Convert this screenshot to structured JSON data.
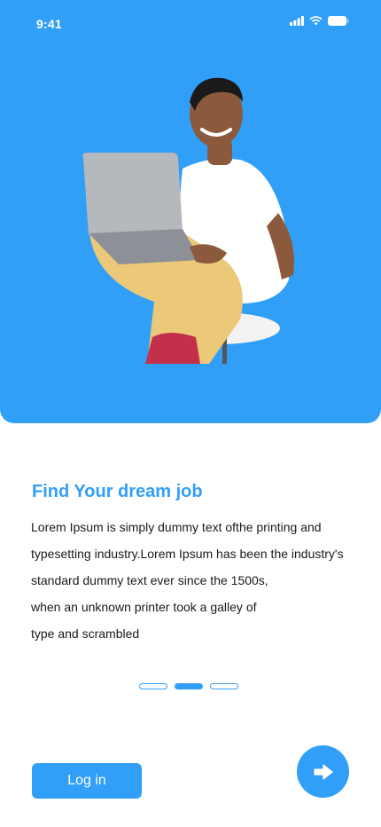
{
  "status_bar": {
    "time": "9:41"
  },
  "onboarding": {
    "title": "Find Your dream job",
    "body_lines": [
      "Lorem Ipsum is simply dummy text ofthe printing and",
      "typesetting industry.Lorem Ipsum has been the industry's",
      "standard dummy text ever since the 1500s,",
      "when an unknown printer took a galley of",
      "type and scrambled"
    ],
    "progress": {
      "total_pages": 3,
      "current_page": 2
    }
  },
  "actions": {
    "login_label": "Log in",
    "next_icon": "arrow-right-icon"
  },
  "colors": {
    "accent": "#319ff8",
    "background": "#ffffff",
    "text": "#1a1a1a"
  }
}
